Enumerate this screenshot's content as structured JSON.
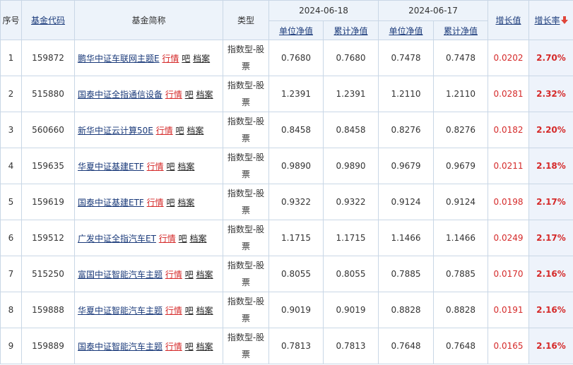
{
  "header": {
    "seq": "序号",
    "code": "基金代码",
    "name": "基金简称",
    "type": "类型",
    "date1": "2024-06-18",
    "date2": "2024-06-17",
    "unit_nav": "单位净值",
    "cum_nav": "累计净值",
    "growth_value": "增长值",
    "growth_rate": "增长率"
  },
  "link_labels": {
    "quote": "行情",
    "bar": "吧",
    "archive": "档案"
  },
  "sort_icon": "sort-down-arrow-icon",
  "colors": {
    "header_bg": "#edf3fa",
    "border": "#c9d7e6",
    "red": "#d52a2a",
    "link": "#1a3a7a"
  },
  "rows": [
    {
      "seq": "1",
      "code": "159872",
      "name": "鹏华中证车联网主题E",
      "type": "指数型-股票",
      "nav1": "0.7680",
      "cum1": "0.7680",
      "nav2": "0.7478",
      "cum2": "0.7478",
      "growth": "0.0202",
      "rate": "2.70%"
    },
    {
      "seq": "2",
      "code": "515880",
      "name": "国泰中证全指通信设备",
      "type": "指数型-股票",
      "nav1": "1.2391",
      "cum1": "1.2391",
      "nav2": "1.2110",
      "cum2": "1.2110",
      "growth": "0.0281",
      "rate": "2.32%"
    },
    {
      "seq": "3",
      "code": "560660",
      "name": "新华中证云计算50E",
      "type": "指数型-股票",
      "nav1": "0.8458",
      "cum1": "0.8458",
      "nav2": "0.8276",
      "cum2": "0.8276",
      "growth": "0.0182",
      "rate": "2.20%"
    },
    {
      "seq": "4",
      "code": "159635",
      "name": "华夏中证基建ETF",
      "type": "指数型-股票",
      "nav1": "0.9890",
      "cum1": "0.9890",
      "nav2": "0.9679",
      "cum2": "0.9679",
      "growth": "0.0211",
      "rate": "2.18%"
    },
    {
      "seq": "5",
      "code": "159619",
      "name": "国泰中证基建ETF",
      "type": "指数型-股票",
      "nav1": "0.9322",
      "cum1": "0.9322",
      "nav2": "0.9124",
      "cum2": "0.9124",
      "growth": "0.0198",
      "rate": "2.17%"
    },
    {
      "seq": "6",
      "code": "159512",
      "name": "广发中证全指汽车ET",
      "type": "指数型-股票",
      "nav1": "1.1715",
      "cum1": "1.1715",
      "nav2": "1.1466",
      "cum2": "1.1466",
      "growth": "0.0249",
      "rate": "2.17%"
    },
    {
      "seq": "7",
      "code": "515250",
      "name": "富国中证智能汽车主题",
      "type": "指数型-股票",
      "nav1": "0.8055",
      "cum1": "0.8055",
      "nav2": "0.7885",
      "cum2": "0.7885",
      "growth": "0.0170",
      "rate": "2.16%"
    },
    {
      "seq": "8",
      "code": "159888",
      "name": "华夏中证智能汽车主题",
      "type": "指数型-股票",
      "nav1": "0.9019",
      "cum1": "0.9019",
      "nav2": "0.8828",
      "cum2": "0.8828",
      "growth": "0.0191",
      "rate": "2.16%"
    },
    {
      "seq": "9",
      "code": "159889",
      "name": "国泰中证智能汽车主题",
      "type": "指数型-股票",
      "nav1": "0.7813",
      "cum1": "0.7813",
      "nav2": "0.7648",
      "cum2": "0.7648",
      "growth": "0.0165",
      "rate": "2.16%"
    }
  ]
}
